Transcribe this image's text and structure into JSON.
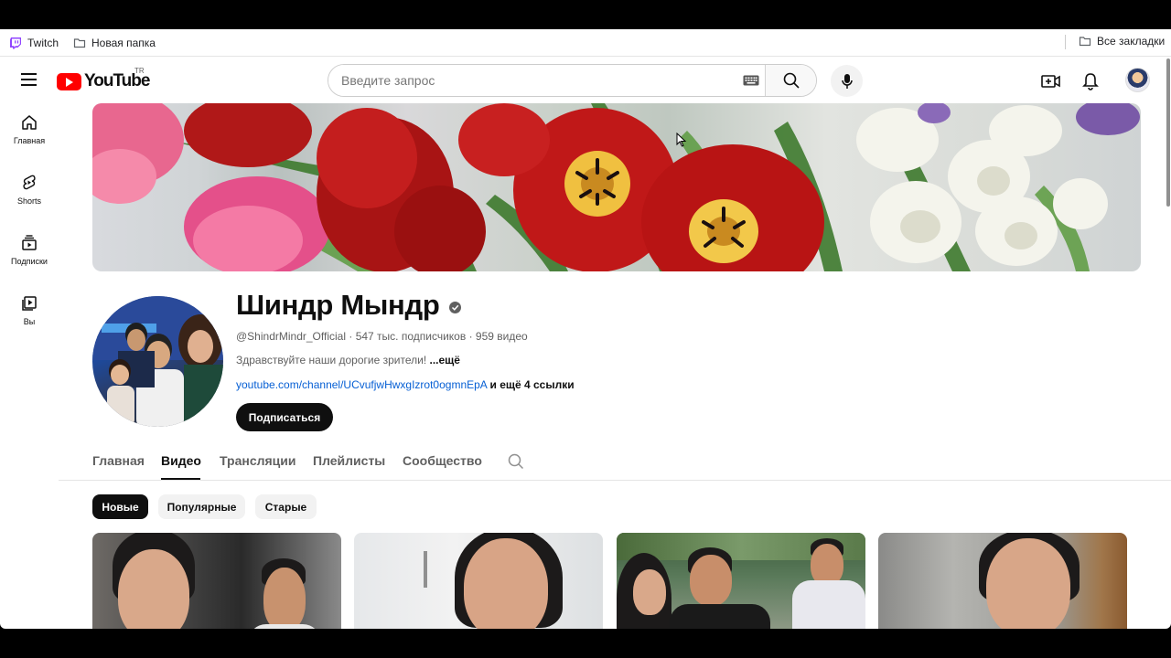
{
  "bookmarks": {
    "items": [
      {
        "label": "Twitch",
        "icon": "twitch-icon",
        "color": "#9146ff"
      },
      {
        "label": "Новая папка",
        "icon": "folder-icon"
      }
    ],
    "all_bookmarks": "Все закладки"
  },
  "masthead": {
    "logo_text": "YouTube",
    "region": "TR",
    "search_placeholder": "Введите запрос"
  },
  "sidebar": {
    "items": [
      {
        "label": "Главная",
        "icon": "home-icon"
      },
      {
        "label": "Shorts",
        "icon": "shorts-icon"
      },
      {
        "label": "Подписки",
        "icon": "subscriptions-icon"
      },
      {
        "label": "Вы",
        "icon": "library-icon"
      }
    ]
  },
  "channel": {
    "name": "Шиндр Мындр",
    "verified": true,
    "handle": "@ShindrMindr_Official",
    "subscribers": "547 тыс. подписчиков",
    "videos": "959 видео",
    "description": "Здравствуйте наши дорогие зрители!",
    "more": "...ещё",
    "link": "youtube.com/channel/UCvufjwHwxgIzrot0ogmnEpA",
    "more_links": "и ещё 4 ссылки",
    "subscribe_label": "Подписаться"
  },
  "tabs": [
    {
      "label": "Главная",
      "active": false
    },
    {
      "label": "Видео",
      "active": true
    },
    {
      "label": "Трансляции",
      "active": false
    },
    {
      "label": "Плейлисты",
      "active": false
    },
    {
      "label": "Сообщество",
      "active": false
    }
  ],
  "chips": [
    {
      "label": "Новые",
      "active": true
    },
    {
      "label": "Популярные",
      "active": false
    },
    {
      "label": "Старые",
      "active": false
    }
  ],
  "colors": {
    "brand_red": "#ff0000",
    "link_blue": "#065fd4",
    "text_primary": "#0f0f0f",
    "text_secondary": "#606060"
  }
}
